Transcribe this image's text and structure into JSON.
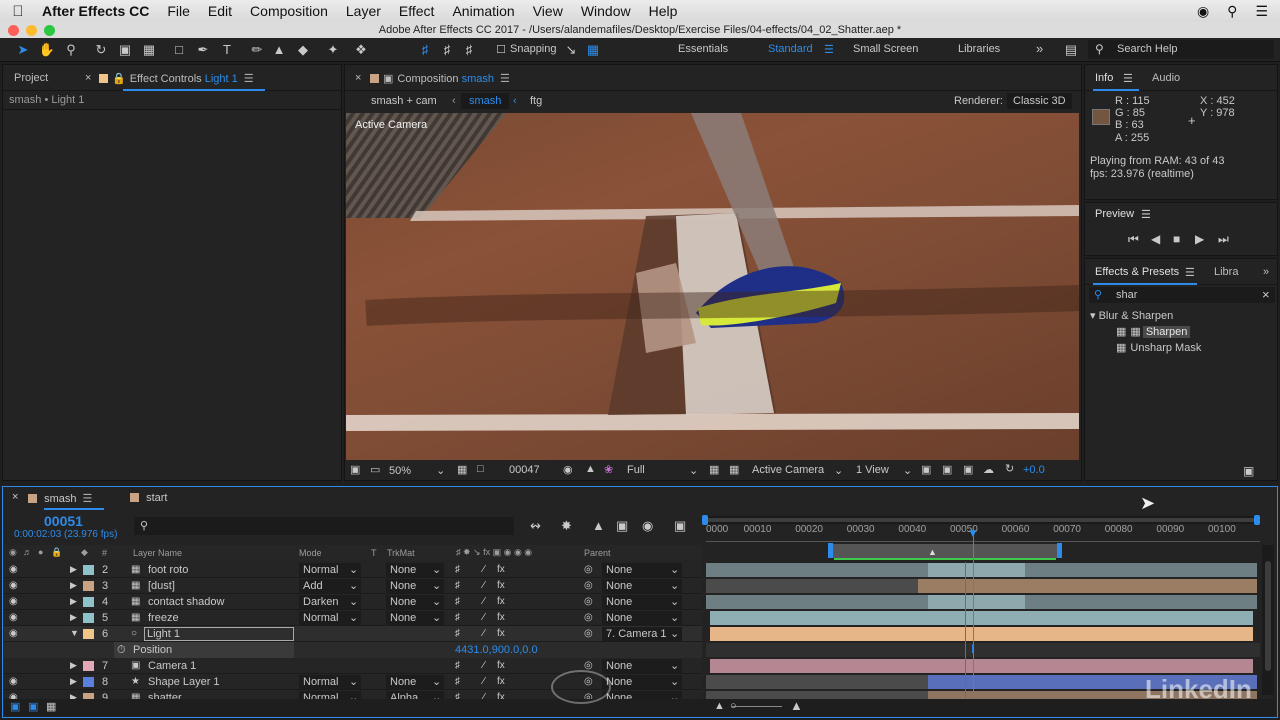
{
  "menubar": {
    "app": "After Effects CC",
    "items": [
      "File",
      "Edit",
      "Composition",
      "Layer",
      "Effect",
      "Animation",
      "View",
      "Window",
      "Help"
    ]
  },
  "window_title": "Adobe After Effects CC 2017 - /Users/alandemafiles/Desktop/Exercise Files/04-effects/04_02_Shatter.aep *",
  "toolbar": {
    "snapping_label": "Snapping",
    "workspaces": [
      "Essentials",
      "Standard",
      "Small Screen",
      "Libraries"
    ],
    "search_help": "Search Help"
  },
  "project_panel": {
    "tab_project": "Project",
    "tab_effect_controls_prefix": "Effect Controls",
    "tab_effect_controls_layer": "Light 1",
    "breadcrumb": "smash • Light 1"
  },
  "comp_panel": {
    "tab_prefix": "Composition",
    "tab_name": "smash",
    "nav": [
      "smash + cam",
      "smash",
      "ftg"
    ],
    "renderer_label": "Renderer:",
    "renderer_value": "Classic 3D",
    "overlay_label": "Active Camera",
    "footer": {
      "zoom": "50%",
      "timecode": "00047",
      "resolution": "Full",
      "camera": "Active Camera",
      "views": "1 View",
      "exposure": "+0.0"
    }
  },
  "info_panel": {
    "tab_info": "Info",
    "tab_audio": "Audio",
    "r": "R : 115",
    "g": "G : 85",
    "b": "B : 63",
    "a": "A : 255",
    "x": "X : 452",
    "y": "Y : 978",
    "status_line1": "Playing from RAM: 43 of 43",
    "status_line2": "fps: 23.976 (realtime)",
    "swatch_color": "#735540"
  },
  "preview_panel": {
    "title": "Preview"
  },
  "effects_panel": {
    "tab_effects": "Effects & Presets",
    "tab_libra": "Libra",
    "search_value": "shar",
    "category": "Blur & Sharpen",
    "items": [
      "Sharpen",
      "Unsharp Mask"
    ]
  },
  "timeline": {
    "tab_comp": "smash",
    "tab_start": "start",
    "current_frame": "00051",
    "current_time": "0:00:02:03 (23.976 fps)",
    "columns": {
      "hash": "#",
      "layer_name": "Layer Name",
      "mode": "Mode",
      "t": "T",
      "trkmat": "TrkMat",
      "parent": "Parent"
    },
    "ruler_ticks": [
      "0000",
      "00010",
      "00020",
      "00030",
      "00040",
      "00050",
      "00060",
      "00070",
      "00080",
      "00090",
      "00100"
    ],
    "layers": [
      {
        "num": "2",
        "name": "foot roto",
        "mode": "Normal",
        "trkmat": "None",
        "parent": "None",
        "label_color": "#8fc1c9"
      },
      {
        "num": "3",
        "name": "[dust]",
        "mode": "Add",
        "trkmat": "None",
        "parent": "None",
        "label_color": "#c9a383"
      },
      {
        "num": "4",
        "name": "contact shadow",
        "mode": "Darken",
        "trkmat": "None",
        "parent": "None",
        "label_color": "#8fc1c9"
      },
      {
        "num": "5",
        "name": "freeze",
        "mode": "Normal",
        "trkmat": "None",
        "parent": "None",
        "label_color": "#8fc1c9"
      },
      {
        "num": "6",
        "name": "Light 1",
        "mode": "",
        "trkmat": "",
        "parent": "7. Camera 1",
        "label_color": "#f0c58a"
      },
      {
        "num": "7",
        "name": "Camera 1",
        "mode": "",
        "trkmat": "",
        "parent": "None",
        "label_color": "#e3a8b5"
      },
      {
        "num": "8",
        "name": "Shape Layer 1",
        "mode": "Normal",
        "trkmat": "None",
        "parent": "None",
        "label_color": "#5b7fdc"
      },
      {
        "num": "9",
        "name": "shatter",
        "mode": "Normal",
        "trkmat": "Alpha",
        "parent": "None",
        "label_color": "#c9a383"
      }
    ],
    "property": {
      "name": "Position",
      "value": "4431.0,900.0,0.0"
    }
  },
  "watermark": "LinkedIn"
}
